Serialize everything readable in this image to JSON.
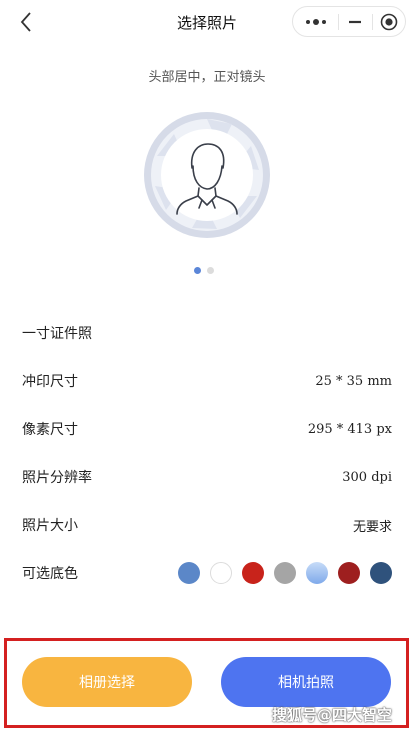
{
  "nav": {
    "title": "选择照片"
  },
  "icons": {
    "back": "chevron-left-icon",
    "more": "more-dots-icon",
    "minimize": "minimize-icon",
    "close": "target-close-icon",
    "avatar": "person-silhouette-icon"
  },
  "hint": "头部居中，正对镜头",
  "pager": {
    "count": 2,
    "active_index": 0
  },
  "spec": {
    "name": "一寸证件照",
    "rows": [
      {
        "label": "冲印尺寸",
        "value": "25 * 35 mm"
      },
      {
        "label": "像素尺寸",
        "value": "295 * 413 px"
      },
      {
        "label": "照片分辨率",
        "value": "300 dpi"
      },
      {
        "label": "照片大小",
        "value": "无要求"
      }
    ],
    "bg_label": "可选底色",
    "bg_colors": [
      "#5b87c8",
      "#ffffff",
      "#c8231b",
      "#a5a5a5",
      "#8fb8ef",
      "#9e1f1f",
      "#2f527c"
    ]
  },
  "actions": {
    "album": "相册选择",
    "camera": "相机拍照"
  },
  "watermark": "搜狐号@四大智空",
  "colors": {
    "album": "#f8b540",
    "camera": "#4e74f0",
    "highlight": "#d42020",
    "pager_active": "#5b86d8"
  }
}
